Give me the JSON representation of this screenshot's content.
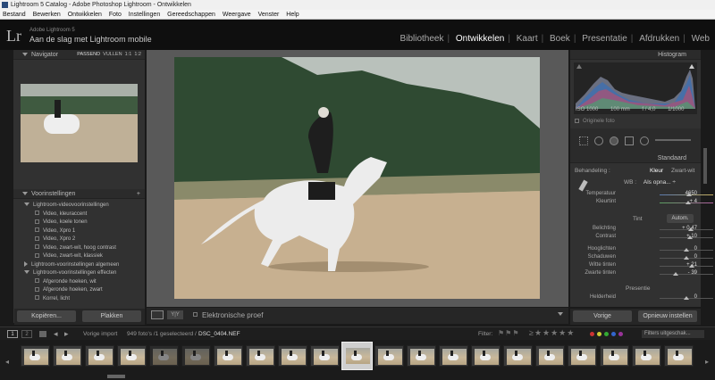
{
  "window": {
    "title": "Lightroom 5 Catalog - Adobe Photoshop Lightroom - Ontwikkelen"
  },
  "menu": [
    "Bestand",
    "Bewerken",
    "Ontwikkelen",
    "Foto",
    "Instellingen",
    "Gereedschappen",
    "Weergave",
    "Venster",
    "Help"
  ],
  "identity": {
    "logo": "Lr",
    "product": "Adobe Lightroom 5",
    "tagline": "Aan de slag met Lightroom mobile"
  },
  "modules": [
    "Bibliotheek",
    "Ontwikkelen",
    "Kaart",
    "Boek",
    "Presentatie",
    "Afdrukken",
    "Web"
  ],
  "active_module": "Ontwikkelen",
  "navigator": {
    "title": "Navigator",
    "opts": [
      "PASSEND",
      "VULLEN",
      "1:1",
      "1:2"
    ]
  },
  "presets": {
    "title": "Voorinstellingen",
    "add": "+",
    "group1": "Lightroom-videovoorinstellingen",
    "items1": [
      "Video, kleuraccent",
      "Video, koele tonen",
      "Video, Xpro 1",
      "Video, Xpro 2",
      "Video, zwart-wit, hoog contrast",
      "Video, zwart-wit, klassiek"
    ],
    "group2": "Lightroom-voorinstellingen algemeen",
    "group3": "Lightroom-voorinstellingen effecten",
    "items3": [
      "Afgeronde hoeken, wit",
      "Afgeronde hoeken, zwart",
      "Korrel, licht"
    ]
  },
  "left_buttons": {
    "copy": "Kopiëren...",
    "paste": "Plakken"
  },
  "toolbar": {
    "proof_label": "Elektronische proef",
    "view_yy": "Y|Y"
  },
  "histogram": {
    "title": "Histogram",
    "iso": "ISO 1000",
    "focal": "100 mm",
    "aperture": "f / 4,0",
    "shutter": "1/1000",
    "original": "Originele foto"
  },
  "basic": {
    "title": "Standaard",
    "treatment_label": "Behandeling :",
    "treatment_color": "Kleur",
    "treatment_bw": "Zwart-wit",
    "wb_label": "WB :",
    "wb_value": "Als opna... ÷",
    "temp_label": "Temperatuur",
    "temp_val": "4650",
    "tint_label": "Kleurtint",
    "tint_val": "+ 4",
    "tone_label": "Tint",
    "auto": "Autom.",
    "exposure_label": "Belichting",
    "exposure_val": "+ 0,47",
    "contrast_label": "Contrast",
    "contrast_val": "+ 10",
    "highlights_label": "Hooglichten",
    "highlights_val": "0",
    "shadows_label": "Schaduwen",
    "shadows_val": "0",
    "whites_label": "Witte tinten",
    "whites_val": "+ 21",
    "blacks_label": "Zwarte tinten",
    "blacks_val": "- 39",
    "presence_label": "Presentie",
    "clarity_label": "Helderheid",
    "clarity_val": "0"
  },
  "right_buttons": {
    "previous": "Vorige",
    "reset": "Opnieuw instellen"
  },
  "filmstrip_bar": {
    "page1": "1",
    "page2": "2",
    "source": "Vorige import",
    "count": "949 foto's /1 geselecteerd /",
    "file": "DSC_0404.NEF",
    "filter_label": "Filter:",
    "filter_off": "Filters uitgeschak..."
  },
  "colors": {
    "accent": "#ffffff",
    "panel": "#313131",
    "background": "#1a1a1a"
  }
}
